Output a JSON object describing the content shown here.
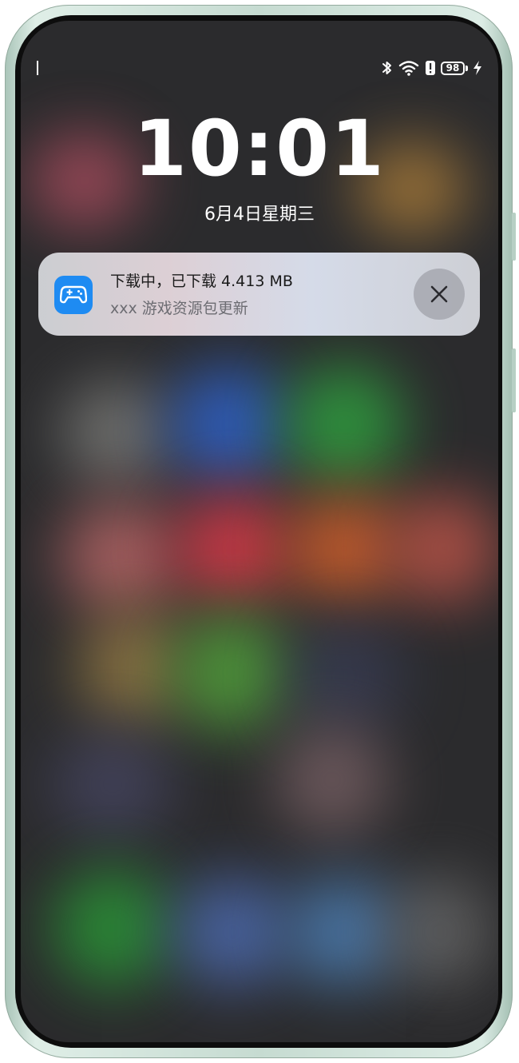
{
  "status_bar": {
    "battery_level": "98",
    "icons": [
      "bluetooth-icon",
      "wifi-icon",
      "alert-icon",
      "battery-icon",
      "charging-icon"
    ]
  },
  "lock_screen": {
    "time": "10:01",
    "date": "6月4日星期三"
  },
  "notification": {
    "title": "下载中，已下载 4.413 MB",
    "subtitle": "xxx 游戏资源包更新",
    "app_icon": "gamepad-icon",
    "app_icon_color": "#1e8bf2",
    "close_icon": "close-icon"
  }
}
